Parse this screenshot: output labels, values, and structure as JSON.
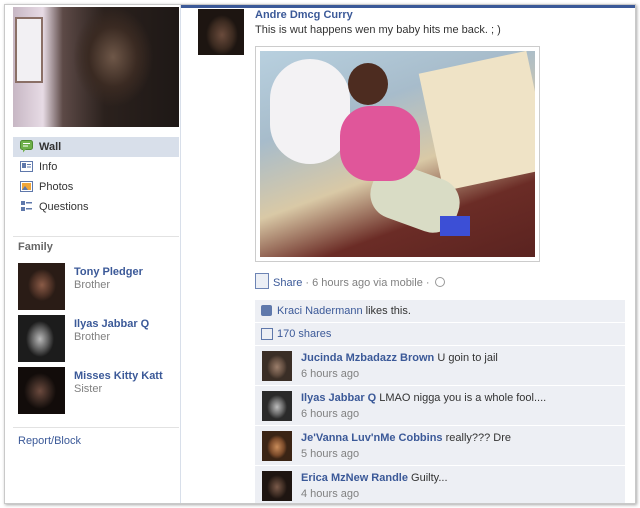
{
  "nav": {
    "items": [
      {
        "label": "Wall",
        "icon": "wall-icon",
        "active": true
      },
      {
        "label": "Info",
        "icon": "info-icon"
      },
      {
        "label": "Photos",
        "icon": "photos-icon"
      },
      {
        "label": "Questions",
        "icon": "questions-icon"
      }
    ]
  },
  "family": {
    "title": "Family",
    "members": [
      {
        "name": "Tony Pledger",
        "relation": "Brother"
      },
      {
        "name": "Ilyas Jabbar Q",
        "relation": "Brother"
      },
      {
        "name": "Misses Kitty Katt",
        "relation": "Sister"
      }
    ]
  },
  "report_block": "Report/Block",
  "post": {
    "author": "Andre Dmcg Curry",
    "message": "This is wut happens wen my baby hits me back. ; )",
    "share_label": "Share",
    "meta": " · 6 hours ago via mobile · "
  },
  "ufi": {
    "like_user": "Kraci Nadermann",
    "like_suffix": " likes this.",
    "shares": "170 shares"
  },
  "comments": [
    {
      "author": "Jucinda Mzbadazz Brown",
      "text": "U goin to jail",
      "time": "6 hours ago"
    },
    {
      "author": "Ilyas Jabbar Q",
      "text": "LMAO nigga you is a whole fool....",
      "time": "6 hours ago"
    },
    {
      "author": "Je'Vanna Luv'nMe Cobbins",
      "text": "really??? Dre",
      "time": "5 hours ago"
    },
    {
      "author": "Erica MzNew Randle",
      "text": "Guilty...",
      "time": "4 hours ago"
    }
  ],
  "colors": {
    "link": "#3b5998",
    "ufi_bg": "#edeff4",
    "nav_active": "#d8dfea"
  }
}
